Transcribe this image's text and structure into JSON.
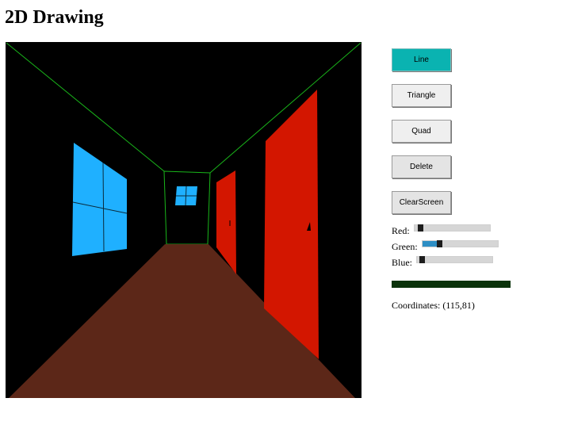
{
  "page": {
    "title": "2D Drawing"
  },
  "toolbar": {
    "buttons": [
      {
        "label": "Line",
        "active": true
      },
      {
        "label": "Triangle",
        "active": false
      },
      {
        "label": "Quad",
        "active": false
      },
      {
        "label": "Delete",
        "active": false
      },
      {
        "label": "ClearScreen",
        "active": false
      }
    ]
  },
  "color_controls": {
    "red": {
      "label": "Red:",
      "value": 0.05
    },
    "green": {
      "label": "Green:",
      "value": 0.2
    },
    "blue": {
      "label": "Blue:",
      "value": 0.03
    },
    "current_color": "#0b330b"
  },
  "status": {
    "coordinates_label": "Coordinates:",
    "coordinates_value": "(115,81)"
  },
  "canvas": {
    "background": "#000000",
    "palette": {
      "line": "#19b51a",
      "window": "#1fb0ff",
      "floor": "#5c2718",
      "door": "#d31600",
      "divider": "#0b2a3a"
    }
  }
}
